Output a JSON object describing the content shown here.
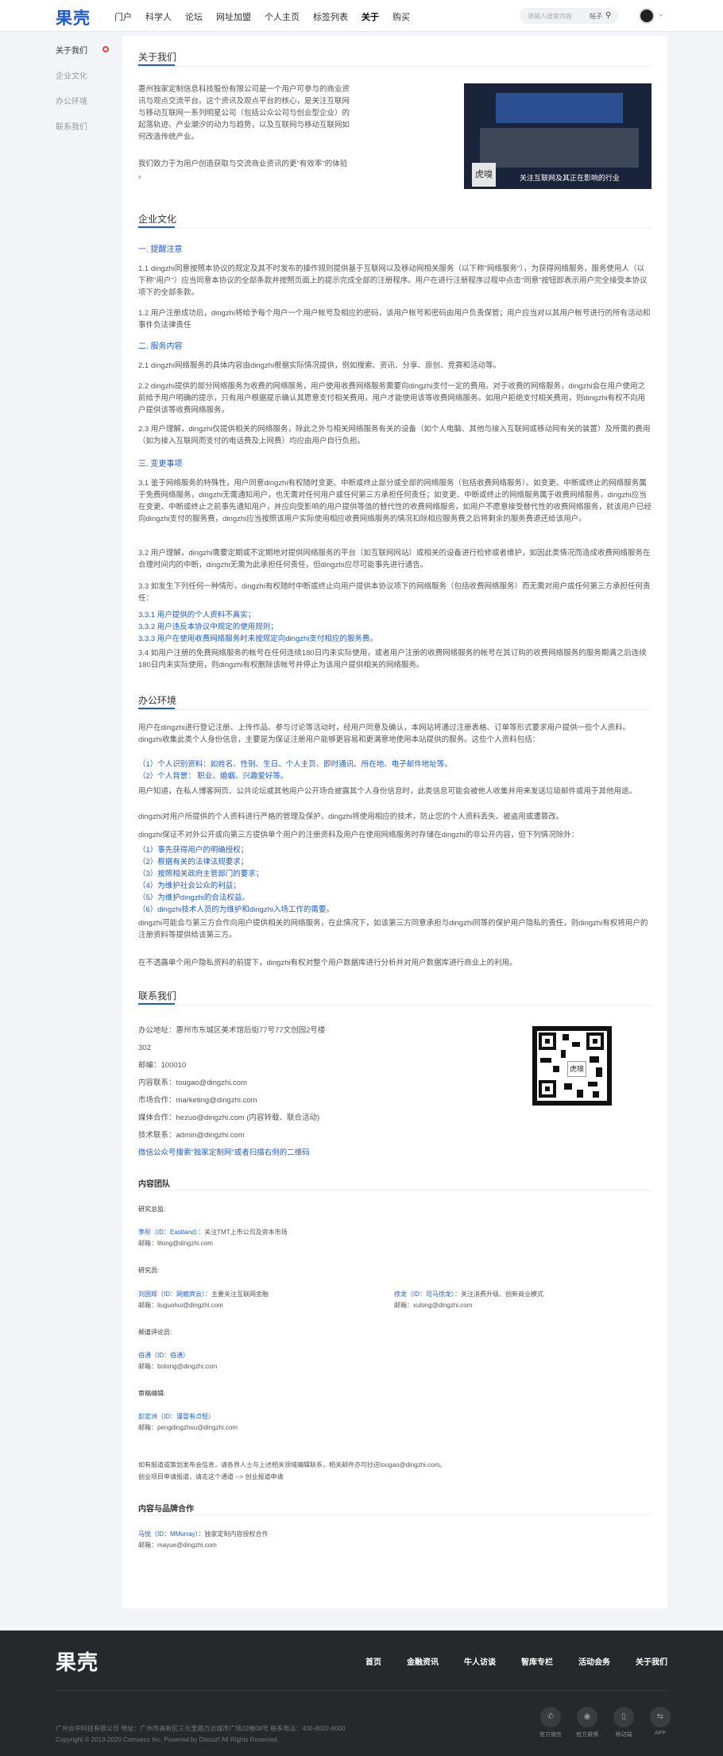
{
  "header": {
    "logo": "果壳",
    "nav": [
      "门户",
      "科学人",
      "论坛",
      "网址加盟",
      "个人主页",
      "标签列表",
      "关于",
      "购买"
    ],
    "nav_active": 6,
    "search_placeholder": "请输入搜索内容",
    "search_scope": "帖子",
    "search_icon": "search-icon",
    "avatar_icon": "avatar"
  },
  "sidebar": {
    "items": [
      "关于我们",
      "企业文化",
      "办公环境",
      "联系我们"
    ],
    "active": 0
  },
  "about": {
    "title": "关于我们",
    "p1": "惠州独家定制信息科技股份有限公司是一个用户可参与的商业资讯与观点交流平台。这个资讯及观点平台的核心，是关注互联网与移动互联网一系列明星公司（包括公众公司与创业型企业）的起落轨迹、产业潮汐的动力与趋势，以及互联网与移动互联网如何改造传统产业。",
    "p2": "我们致力于为用户创造获取与交流商业资讯的更\"有效率\"的体验 。",
    "img_seal": "虎嗅",
    "img_caption": "关注互联网及其正在影响的行业"
  },
  "culture": {
    "title": "企业文化",
    "s1": "一. 提醒注意",
    "p1_1": "1.1 dingzhi同意按照本协议的规定及其不时发布的操作规则提供基于互联网以及移动网相关服务（以下称\"网络服务\"），为获得网络服务，服务使用人（以下称\"用户\"）应当同意本协议的全部条款并按照页面上的提示完成全部的注册程序。用户在进行注册程序过程中点击\"同意\"按钮即表示用户完全接受本协议项下的全部条款。",
    "p1_2": "1.2 用户注册成功后，dingzhi将给予每个用户一个用户帐号及相应的密码，该用户帐号和密码由用户负责保管；用户应当对以其用户帐号进行的所有活动和事件负法律责任",
    "s2": "二. 服务内容",
    "p2_1": "2.1 dingzhi网络服务的具体内容由dingzhi根据实际情况提供，例如搜索、资讯、分享、原创、竞赛和活动等。",
    "p2_2": "2.2 dingzhi提供的部分网络服务为收费的网络服务，用户使用收费网络服务需要向dingzhi支付一定的费用。对于收费的网络服务，dingzhi会在用户使用之前给予用户明确的提示，只有用户根据提示确认其愿意支付相关费用，用户才能使用该等收费网络服务。如用户拒绝支付相关费用，则dingzhi有权不向用户提供该等收费网络服务。",
    "p2_3": "2.3 用户理解，dingzhi仅提供相关的网络服务，除此之外与相关网络服务有关的设备（如个人电脑、其他与接入互联网或移动网有关的装置）及所需的费用（如为接入互联网而支付的电话费及上网费）均应由用户自行负担。",
    "s3": "三. 变更事项",
    "p3_1": "3.1 鉴于网络服务的特殊性，用户同意dingzhi有权随时变更、中断或终止部分或全部的网络服务（包括收费网络服务）。如变更、中断或终止的网络服务属于免费网络服务，dingzhi无需通知用户，也无需对任何用户或任何第三方承担任何责任；如变更、中断或终止的网络服务属于收费网络服务，dingzhi应当在变更、中断或终止之前事先通知用户，并应向受影响的用户提供等值的替代性的收费网络服务，如用户不愿意接受替代性的收费网络服务，就该用户已经向dingzhi支付的服务费，dingzhi应当按照该用户实际使用相应收费网络服务的情况扣除相应服务费之后将剩余的服务费退还给该用户。",
    "p3_2": "3.2 用户理解，dingzhi需要定期或不定期地对提供网络服务的平台（如互联网网站）或相关的设备进行检修或者维护，如因此类情况而造成收费网络服务在合理时间内的中断，dingzhi无需为此承担任何责任，但dingzhi应尽可能事先进行通告。",
    "p3_3": "3.3 如发生下列任何一种情形，dingzhi有权随时中断或终止向用户提供本协议项下的网络服务（包括收费网络服务）而无需对用户或任何第三方承担任何责任：",
    "l1": "3.3.1 用户提供的个人资料不真实；",
    "l2": "3.3.2 用户违反本协议中规定的使用规则；",
    "l3": "3.3.3 用户在使用收费网络服务时未按规定向dingzhi支付相应的服务费。",
    "p3_4": "3.4 如用户注册的免费网络服务的帐号在任何连续180日内未实际使用，或者用户注册的收费网络服务的帐号在其订购的收费网络服务的服务期满之后连续180日内未实际使用，则dingzhi有权删除该帐号并停止为该用户提供相关的网络服务。"
  },
  "office": {
    "title": "办公环境",
    "p1": "用户在dingzhi进行登记注册、上传作品、参与讨论等活动时，经用户同意及确认，本网站将通过注册表格、订单等形式要求用户提供一些个人资料。dingzhi收集此类个人身份信息，主要是为保证注册用户能够更容易和更满意地使用本站提供的服务。这些个人资料包括：",
    "i1": "（1）个人识别资料：如姓名、性别、生日、个人主页、即时通讯、所在地、电子邮件地址等。",
    "i2": "（2）个人背景： 职业、婚姻、兴趣爱好等。",
    "p2": "用户知道，在私人博客网页、公共论坛或其他用户公开场合披露其个人身份信息时，此类信息可能会被他人收集并用来发送垃圾邮件或用于其他用途。",
    "p3": "dingzhi对用户所提供的个人资料进行严格的管理及保护，dingzhi将使用相应的技术，防止您的个人资料丢失、被盗用或遭篡改。",
    "p4": "dingzhi保证不对外公开或向第三方提供单个用户的注册资料及用户在使用网络服务时存储在dingzhi的非公开内容，但下列情况除外：",
    "e1": "（1）事先获得用户的明确授权；",
    "e2": "（2）根据有关的法律法规要求；",
    "e3": "（3）按照相关政府主管部门的要求；",
    "e4": "（4）为维护社会公众的利益；",
    "e5": "（5）为维护dingzhi的合法权益。",
    "e6": "（6）dingzhi技术人员的为维护和dingzhi入场工作的需要。",
    "p5": "dingzhi可能会与第三方合作向用户提供相关的网络服务，在此情况下，如该第三方同意承担与dingzhi同等的保护用户隐私的责任，则dingzhi有权将用户的注册资料等提供给该第三方。",
    "p6": "在不透露单个用户隐私资料的前提下，dingzhi有权对整个用户数据库进行分析并对用户数据库进行商业上的利用。"
  },
  "contact": {
    "title": "联系我们",
    "addr1": "办公地址：惠州市东城区美术馆后街77号77文创园2号楼",
    "addr2": "302",
    "zip": "邮编：100010",
    "content": "内容联系：tougao@dingzhi.com",
    "market": "市场合作：marketing@dingzhi.com",
    "media": "媒体合作：hezuo@dingzhi.com (内容转载、联合活动)",
    "tech": "技术联系：admin@dingzhi.com",
    "wechat": "微信公众号搜索\"独家定制网\"或者扫描右侧的二维码",
    "qr_seal": "虎嗅"
  },
  "team": {
    "title": "内容团队",
    "g1": "研究总监:",
    "m1_name": "李彤（ID：Eastland）",
    "m1_desc": "：关注TMT上市公司及资本市场",
    "m1_mail": "邮箱：litong@dingzhi.com",
    "g2": "研究员:",
    "m2_name": "刘国辉（ID：网瘾宾云）",
    "m2_desc": "：主要关注互联网金融",
    "m2_mail": "邮箱：liuguohui@dingzhi.com",
    "m3_name": "徐龙（ID：司马徐龙）",
    "m3_desc": "：关注消费升级、创新商业模式",
    "m3_mail": "邮箱：xulong@dingzhi.com",
    "g3": "频道评论员:",
    "m4_name": "伯通（ID：伯通）",
    "m4_mail": "邮箱：botong@dingzhi.com",
    "g4": "审稿编辑:",
    "m5_name": "彭定洲（ID：漫冒有点轻）",
    "m5_mail": "邮箱：pengdingzhou@dingzhi.com",
    "note1": "如有报道或策划发布会信息，请各界人士与上述相关领域编辑联系，相关邮件亦可抄送tougao@dingzhi.com。",
    "note2": "创业项目申请报道，请走这个通道 --> 创业报道申请"
  },
  "brand": {
    "title": "内容与品牌合作",
    "name": "马悦（ID：MMurray）",
    "desc": "：独家定制内容授权合作",
    "mail": "邮箱：mayue@dingzhi.com"
  },
  "footer": {
    "logo": "果壳",
    "nav": [
      "首页",
      "金融资讯",
      "牛人访谈",
      "智库专栏",
      "活动会务",
      "关于我们"
    ],
    "info": "广州云中科技有限公司    地址：广州市高新区三元里路万达城市广场22楼08号    联系电话：400-8002-8000",
    "copy": "Copyright © 2013-2020  Comsenz Inc. Powered by Discuz! All Rights Reserved.",
    "icons": [
      {
        "glyph": "✆",
        "label": "官方微信"
      },
      {
        "glyph": "◉",
        "label": "官方微博"
      },
      {
        "glyph": "▯",
        "label": "移动端"
      },
      {
        "glyph": "⇆",
        "label": "APP"
      }
    ]
  }
}
